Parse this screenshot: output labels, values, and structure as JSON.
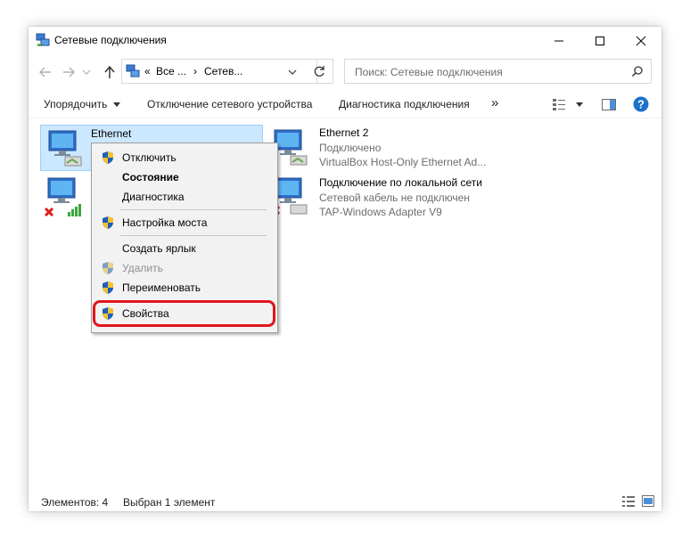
{
  "window": {
    "title": "Сетевые подключения"
  },
  "address": {
    "prefix": "«",
    "segment1": "Все ...",
    "separator": "›",
    "segment2": "Сетев..."
  },
  "search": {
    "placeholder": "Поиск: Сетевые подключения"
  },
  "toolbar": {
    "organize": "Упорядочить",
    "disable": "Отключение сетевого устройства",
    "diagnose": "Диагностика подключения",
    "more": "»"
  },
  "connections": [
    {
      "name": "Ethernet",
      "status": "",
      "adapter": ""
    },
    {
      "name": "Ethernet 2",
      "status": "Подключено",
      "adapter": "VirtualBox Host-Only Ethernet Ad..."
    },
    {
      "name": "Подключение по локальной сети",
      "status": "Сетевой кабель не подключен",
      "adapter": "TAP-Windows Adapter V9"
    }
  ],
  "context_menu": {
    "items": [
      {
        "label": "Отключить"
      },
      {
        "label": "Состояние"
      },
      {
        "label": "Диагностика"
      },
      {
        "label": "Настройка моста"
      },
      {
        "label": "Создать ярлык"
      },
      {
        "label": "Удалить"
      },
      {
        "label": "Переименовать"
      },
      {
        "label": "Свойства"
      }
    ]
  },
  "status_bar": {
    "count": "Элементов: 4",
    "selected": "Выбран 1 элемент"
  },
  "colors": {
    "selection": "#cce8ff",
    "highlight": "#e0151d",
    "help": "#1a73c9"
  }
}
